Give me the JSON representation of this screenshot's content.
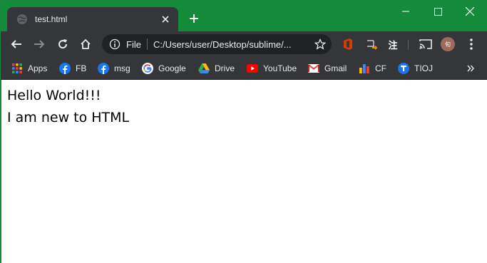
{
  "tab": {
    "title": "test.html"
  },
  "toolbar": {
    "omnibox": {
      "scheme_label": "File",
      "url": "C:/Users/user/Desktop/sublime/..."
    },
    "extensions": [
      {
        "name": "office-icon"
      },
      {
        "name": "orange-extension-icon"
      },
      {
        "name": "chinese-annotation-icon",
        "label": "注"
      }
    ],
    "avatar_label": "旬"
  },
  "bookmarks": [
    {
      "label": "Apps",
      "icon": "apps-grid-icon"
    },
    {
      "label": "FB",
      "icon": "facebook-icon"
    },
    {
      "label": "msg",
      "icon": "facebook-icon"
    },
    {
      "label": "Google",
      "icon": "google-icon"
    },
    {
      "label": "Drive",
      "icon": "google-drive-icon"
    },
    {
      "label": "YouTube",
      "icon": "youtube-icon"
    },
    {
      "label": "Gmail",
      "icon": "gmail-icon"
    },
    {
      "label": "CF",
      "icon": "codeforces-icon"
    },
    {
      "label": "TIOJ",
      "icon": "tioj-icon"
    }
  ],
  "content": {
    "line1": "Hello World!!!",
    "line2": "I am new to HTML"
  },
  "colors": {
    "frame": "#148a3b",
    "toolbar": "#35363a",
    "omnibox": "#202124"
  }
}
